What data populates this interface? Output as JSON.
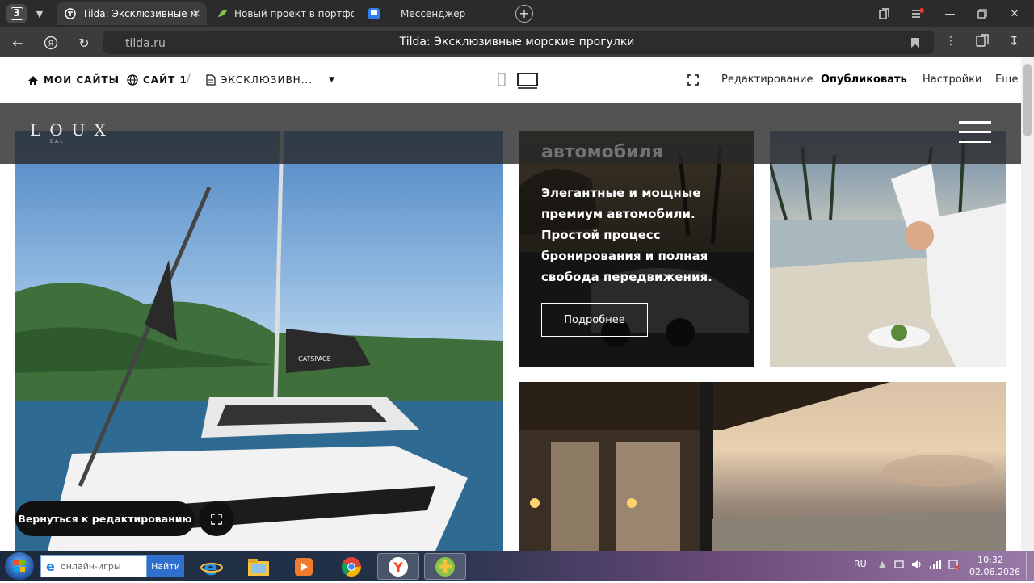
{
  "browser": {
    "tab_count": "3",
    "tabs": [
      {
        "title": "Tilda: Эксклюзивные м",
        "icon": "tilda-icon"
      },
      {
        "title": "Новый проект в портфол",
        "icon": "leaf-icon"
      },
      {
        "title": "Мессенджер",
        "icon": "messenger-icon"
      }
    ],
    "address": {
      "host": "tilda.ru",
      "page_title": "Tilda: Эксклюзивные морские прогулки"
    }
  },
  "tilda_bar": {
    "crumbs": [
      "МОИ САЙТЫ",
      "САЙТ 1",
      "ЭКСКЛЮЗИВН..."
    ],
    "links": {
      "edit": "Редактирование",
      "publish": "Опубликовать",
      "settings": "Настройки",
      "more": "Еще"
    }
  },
  "site": {
    "logo": "LOUX",
    "logo_sub": "BALI",
    "card": {
      "ghost_heading": "автомобиля",
      "text": "Элегантные и мощные премиум автомобили. Простой процесс бронирования и полная свобода передвижения.",
      "button": "Подробнее"
    },
    "yacht_label": "CATSPACE"
  },
  "editor": {
    "back_label": "Вернуться к редактированию"
  },
  "taskbar": {
    "search_placeholder": "онлайн-игры",
    "search_button": "Найти",
    "lang": "RU",
    "time": "10:32",
    "date": "02.06.2026"
  },
  "colors": {
    "accent_blue": "#2f6fce",
    "overlay": "#282828",
    "chrome_dark": "#2b2b2b"
  }
}
